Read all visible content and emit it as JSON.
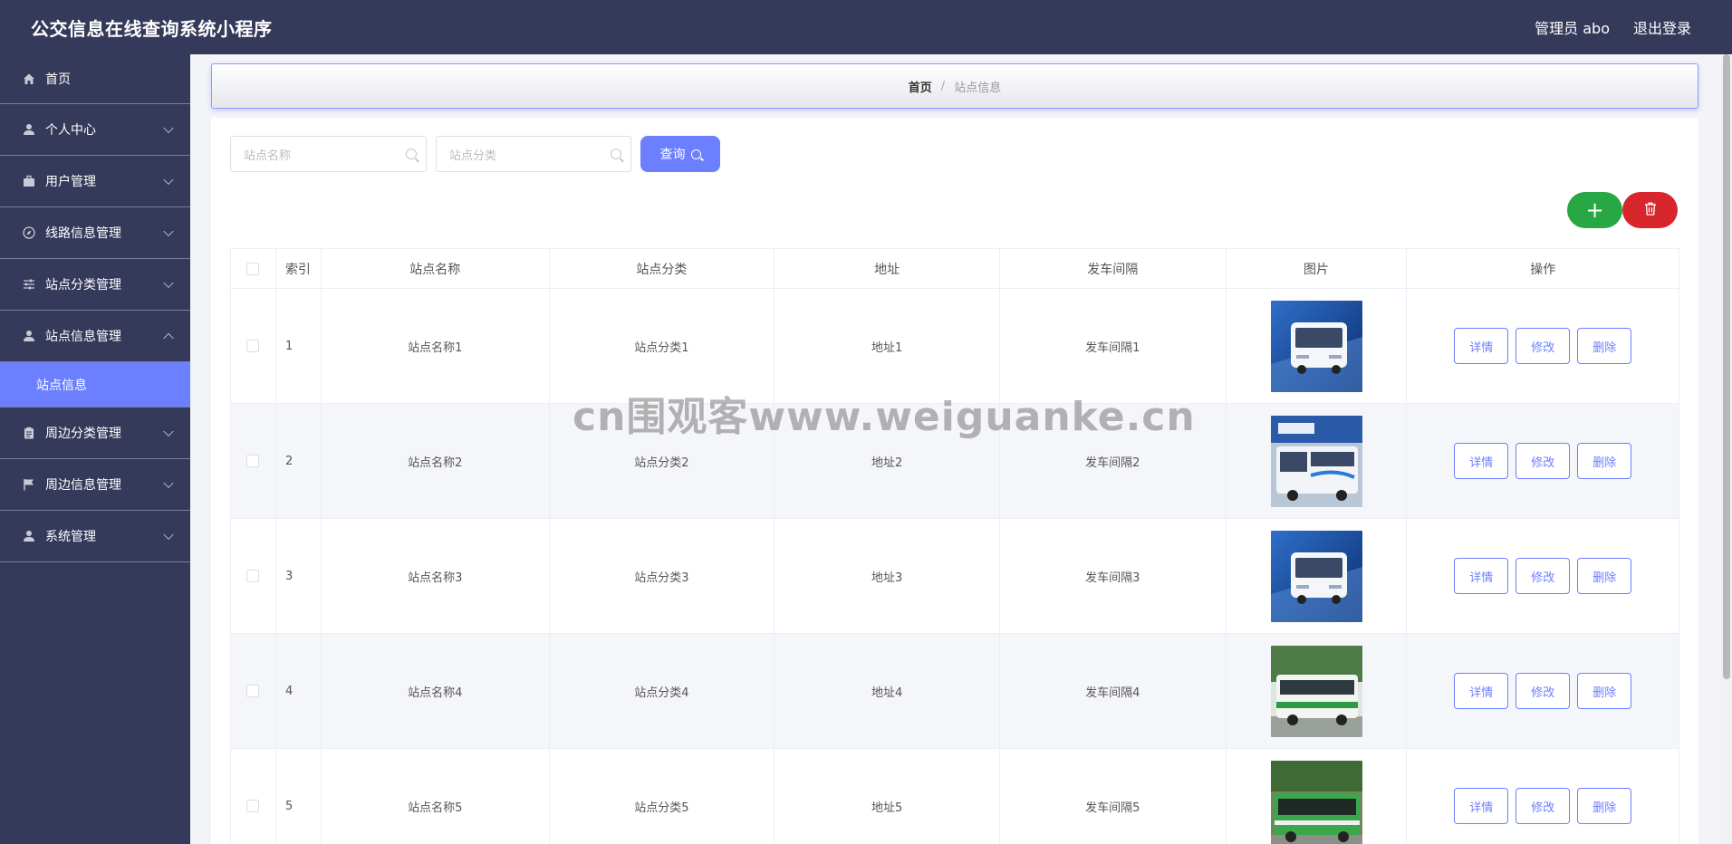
{
  "header": {
    "app_title": "公交信息在线查询系统小程序",
    "user_label": "管理员 abo",
    "logout_label": "退出登录"
  },
  "sidebar": {
    "items": [
      {
        "label": "首页",
        "icon": "home-icon"
      },
      {
        "label": "个人中心",
        "icon": "user-icon"
      },
      {
        "label": "用户管理",
        "icon": "briefcase-icon"
      },
      {
        "label": "线路信息管理",
        "icon": "compass-icon"
      },
      {
        "label": "站点分类管理",
        "icon": "sliders-icon"
      },
      {
        "label": "站点信息管理",
        "icon": "user-icon"
      },
      {
        "label": "周边分类管理",
        "icon": "clipboard-icon"
      },
      {
        "label": "周边信息管理",
        "icon": "flag-icon"
      },
      {
        "label": "系统管理",
        "icon": "user-icon"
      }
    ],
    "active_submenu": "站点信息"
  },
  "breadcrumb": {
    "home": "首页",
    "separator": "/",
    "current": "站点信息"
  },
  "search": {
    "name_placeholder": "站点名称",
    "category_placeholder": "站点分类",
    "query_label": "查询"
  },
  "actions": {
    "add_label": "+"
  },
  "table": {
    "headers": [
      "索引",
      "站点名称",
      "站点分类",
      "地址",
      "发车间隔",
      "图片",
      "操作"
    ],
    "rows": [
      {
        "index": "1",
        "name": "站点名称1",
        "category": "站点分类1",
        "address": "地址1",
        "interval": "发车间隔1"
      },
      {
        "index": "2",
        "name": "站点名称2",
        "category": "站点分类2",
        "address": "地址2",
        "interval": "发车间隔2"
      },
      {
        "index": "3",
        "name": "站点名称3",
        "category": "站点分类3",
        "address": "地址3",
        "interval": "发车间隔3"
      },
      {
        "index": "4",
        "name": "站点名称4",
        "category": "站点分类4",
        "address": "地址4",
        "interval": "发车间隔4"
      },
      {
        "index": "5",
        "name": "站点名称5",
        "category": "站点分类5",
        "address": "地址5",
        "interval": "发车间隔5"
      }
    ],
    "op_labels": {
      "detail": "详情",
      "edit": "修改",
      "delete": "删除"
    }
  },
  "watermark": "cn围观客www.weiguanke.cn",
  "colors": {
    "nav_bg": "#363a5a",
    "accent": "#6b7fff",
    "add_green": "#28a745",
    "delete_red": "#d7272c"
  }
}
